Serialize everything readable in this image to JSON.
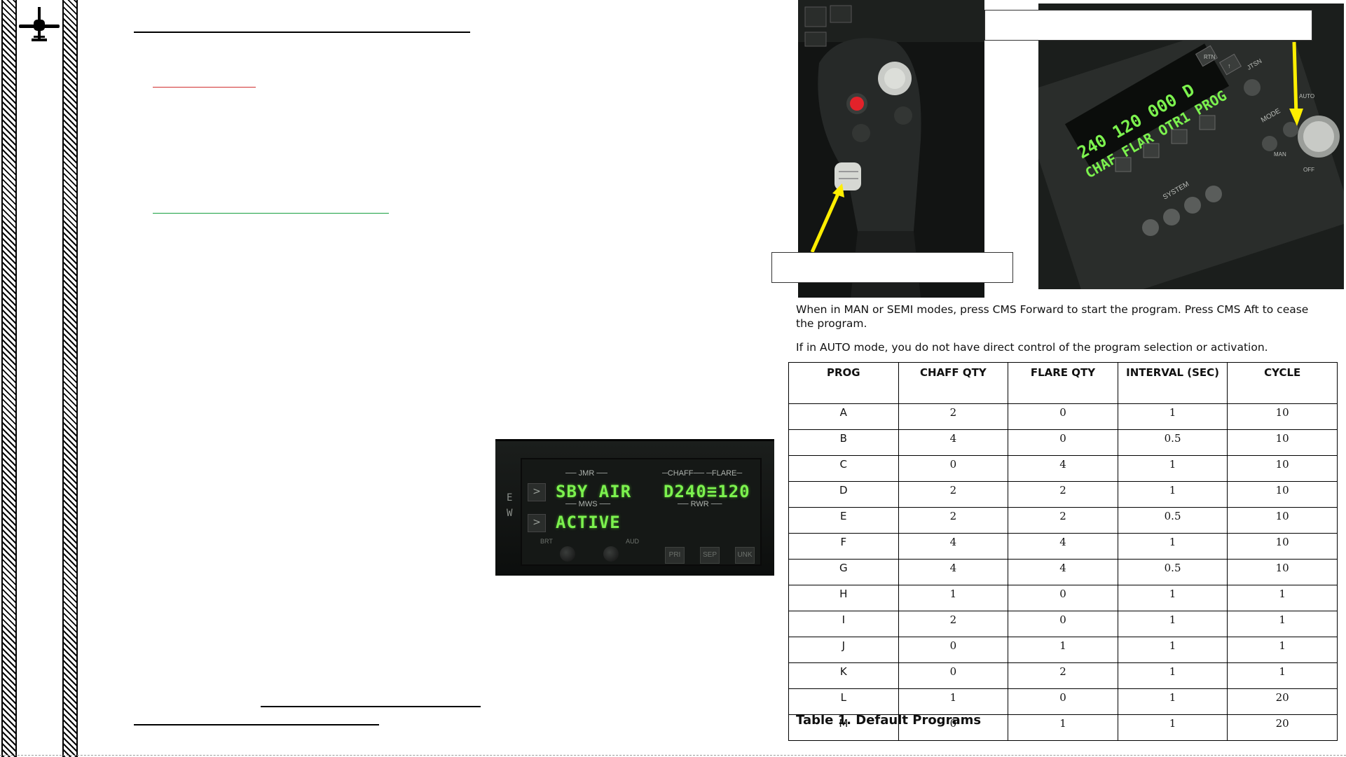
{
  "ew_panel": {
    "side_letters": [
      "E",
      "W"
    ],
    "jmr_label": "JMR",
    "jmr_value": "SBY AIR",
    "mws_label": "MWS",
    "mws_value": "ACTIVE",
    "chaff_label": "CHAFF",
    "flare_label": "FLARE",
    "countermeasures": "D240≡120",
    "rwr_label": "RWR",
    "brt_label": "BRT",
    "aud_label": "AUD",
    "buttons": [
      "PRI",
      "SEP",
      "UNK"
    ]
  },
  "cmsp_display": {
    "line1": "240 120 000 D",
    "line2": "CHAF FLAR OTR1 PROG",
    "labels": {
      "system": "SYSTEM",
      "mode": "MODE",
      "rtn": "RTN",
      "rtn_arrow": "↑",
      "off": "OFF",
      "auto": "AUTO",
      "man": "MAN",
      "jtsn": "JTSN"
    }
  },
  "paragraphs": {
    "p1": "When in MAN or SEMI modes, press CMS Forward to start the program. Press CMS Aft to cease the program.",
    "p2": "If in AUTO mode, you do not have direct control of the program selection or activation."
  },
  "table": {
    "headers": [
      "PROG",
      "CHAFF QTY",
      "FLARE QTY",
      "INTERVAL (SEC)",
      "CYCLE"
    ],
    "rows": [
      [
        "A",
        "2",
        "0",
        "1",
        "10"
      ],
      [
        "B",
        "4",
        "0",
        "0.5",
        "10"
      ],
      [
        "C",
        "0",
        "4",
        "1",
        "10"
      ],
      [
        "D",
        "2",
        "2",
        "1",
        "10"
      ],
      [
        "E",
        "2",
        "2",
        "0.5",
        "10"
      ],
      [
        "F",
        "4",
        "4",
        "1",
        "10"
      ],
      [
        "G",
        "4",
        "4",
        "0.5",
        "10"
      ],
      [
        "H",
        "1",
        "0",
        "1",
        "1"
      ],
      [
        "I",
        "2",
        "0",
        "1",
        "1"
      ],
      [
        "J",
        "0",
        "1",
        "1",
        "1"
      ],
      [
        "K",
        "0",
        "2",
        "1",
        "1"
      ],
      [
        "L",
        "1",
        "0",
        "1",
        "20"
      ],
      [
        "M",
        "0",
        "1",
        "1",
        "20"
      ]
    ],
    "caption": "Table 1. Default Programs"
  },
  "colors": {
    "display_green": "#7cf24e",
    "arrow_yellow": "#ffee00",
    "rule_red": "#d03030",
    "rule_green": "#18a040"
  },
  "icons": [
    "aircraft-icon"
  ]
}
